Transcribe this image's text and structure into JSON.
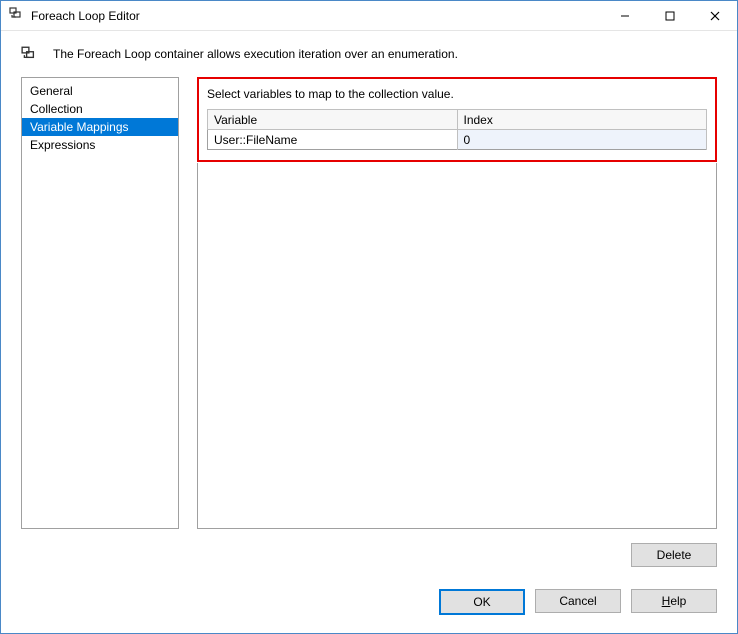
{
  "window": {
    "title": "Foreach Loop Editor"
  },
  "description": "The Foreach Loop container allows execution iteration over an enumeration.",
  "sidebar": {
    "items": [
      {
        "label": "General",
        "selected": false
      },
      {
        "label": "Collection",
        "selected": false
      },
      {
        "label": "Variable Mappings",
        "selected": true
      },
      {
        "label": "Expressions",
        "selected": false
      }
    ]
  },
  "panel": {
    "instruction": "Select variables to map to the collection value.",
    "columns": {
      "variable": "Variable",
      "index": "Index"
    },
    "rows": [
      {
        "variable": "User::FileName",
        "index": "0"
      }
    ]
  },
  "buttons": {
    "delete": "Delete",
    "ok": "OK",
    "cancel": "Cancel",
    "help_prefix": "H",
    "help_rest": "elp"
  }
}
